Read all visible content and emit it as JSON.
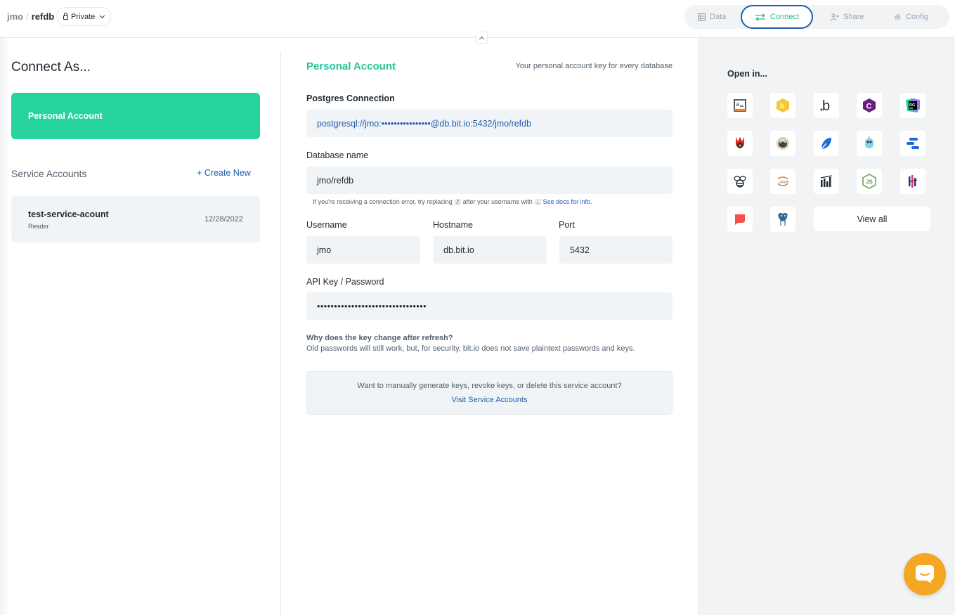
{
  "header": {
    "owner": "jmo",
    "separator": "/",
    "repo": "refdb",
    "privacy": "Private",
    "tabs": [
      {
        "label": "Data",
        "icon": "table-icon"
      },
      {
        "label": "Connect",
        "icon": "connect-arrows-icon"
      },
      {
        "label": "Share",
        "icon": "share-icon"
      },
      {
        "label": "Config",
        "icon": "gear-icon"
      }
    ],
    "active_tab": "Connect"
  },
  "left": {
    "title": "Connect As...",
    "personal_account": "Personal Account",
    "service_accounts_label": "Service Accounts",
    "create_new": "+ Create New",
    "service_accounts": [
      {
        "name": "test-service-acount",
        "role": "Reader",
        "date": "12/28/2022"
      }
    ]
  },
  "main": {
    "title": "Personal Account",
    "subtitle": "Your personal account key for every database",
    "postgres_label": "Postgres Connection",
    "postgres_value": "postgresql://jmo:••••••••••••••••@db.bit.io:5432/jmo/refdb",
    "dbname_label": "Database name",
    "dbname_value": "jmo/refdb",
    "hint": {
      "prefix": "If you're receiving a connection error, try replacing",
      "code1": "/",
      "middle": "after your username with",
      "code2": ".",
      "link": "See docs for info."
    },
    "username_label": "Username",
    "username_value": "jmo",
    "hostname_label": "Hostname",
    "hostname_value": "db.bit.io",
    "port_label": "Port",
    "port_value": "5432",
    "apikey_label": "API Key / Password",
    "apikey_value": "••••••••••••••••••••••••••••••••",
    "why_title": "Why does the key change after refresh?",
    "why_text": "Old passwords will still work, but, for security, bit.io does not save plaintext passwords and keys.",
    "notice_text": "Want to manually generate keys, revoke keys, or delete this service account?",
    "notice_link": "Visit Service Accounts"
  },
  "right": {
    "title": "Open in...",
    "view_all": "View all",
    "tools": [
      {
        "icon": "terminal-a-icon"
      },
      {
        "icon": "bumblebee-b-icon"
      },
      {
        "icon": "bit-b-icon"
      },
      {
        "icon": "c-hexagon-icon"
      },
      {
        "icon": "datagrip-icon"
      },
      {
        "icon": "hex-hand-icon"
      },
      {
        "icon": "badger-icon"
      },
      {
        "icon": "blue-shape-icon"
      },
      {
        "icon": "elephant-robot-icon"
      },
      {
        "icon": "bars-icon"
      },
      {
        "icon": "bee-icon"
      },
      {
        "icon": "jupyter-icon"
      },
      {
        "icon": "bar-chart-icon"
      },
      {
        "icon": "nodejs-icon"
      },
      {
        "icon": "grafana-bars-icon"
      },
      {
        "icon": "speech-bubble-icon"
      },
      {
        "icon": "postgres-elephant-icon"
      }
    ]
  },
  "colors": {
    "accent_green": "#26d39f",
    "link_blue": "#1e5ea8",
    "chat_orange": "#f5a623"
  }
}
